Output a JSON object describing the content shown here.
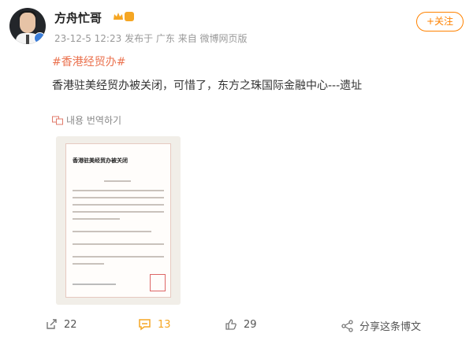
{
  "user": {
    "name": "方舟忙哥",
    "meta_time": "23-12-5 12:23",
    "meta_location": "发布于 广东",
    "meta_source": "来自 微博网页版",
    "follow_label": "+关注"
  },
  "post": {
    "hashtag": "#香港经贸办#",
    "text": "香港驻美经贸办被关闭，可惜了，东方之珠国际金融中心---遗址",
    "translate_label": "내용 번역하기"
  },
  "image": {
    "doc_title": "香港驻美经贸办被关闭"
  },
  "actions": {
    "repost_count": "22",
    "comment_count": "13",
    "like_count": "29",
    "share_label": "分享这条博文"
  },
  "colors": {
    "accent": "#ff8200",
    "hashtag": "#eb7350",
    "meta": "#999999",
    "comment_icon": "#f5a623"
  }
}
